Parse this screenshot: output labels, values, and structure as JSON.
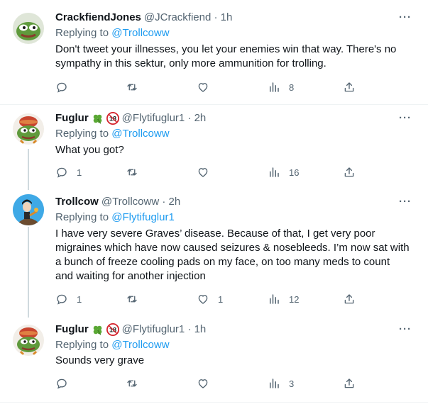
{
  "tweets": [
    {
      "name": "CrackfiendJones",
      "handle_time": "@JCrackfiend · 1h",
      "replying_prefix": "Replying to ",
      "replying_to": "@Trollcoww",
      "text": "Don't tweet your illnesses, you let your enemies win that way. There's no sympathy in this sektur, only more ammunition for trolling.",
      "replies": "",
      "retweets": "",
      "likes": "",
      "views": "8"
    },
    {
      "name": "Fuglur",
      "badges": [
        "four-leaf-clover-icon",
        "18-restriction-icon"
      ],
      "handle_time": "@Flytifuglur1 · 2h",
      "replying_prefix": "Replying to ",
      "replying_to": "@Trollcoww",
      "text": "What you got?",
      "replies": "1",
      "retweets": "",
      "likes": "",
      "views": "16"
    },
    {
      "name": "Trollcow",
      "handle_time": "@Trollcoww · 2h",
      "replying_prefix": "Replying to ",
      "replying_to": "@Flytifuglur1",
      "text": "I have very severe Graves’ disease. Because of that, I get very poor migraines which have now caused seizures & nosebleeds. I’m now sat with a bunch of freeze cooling pads on my face, on too many meds to count and waiting for another injection",
      "replies": "1",
      "retweets": "",
      "likes": "1",
      "views": "12"
    },
    {
      "name": "Fuglur",
      "badges": [
        "four-leaf-clover-icon",
        "18-restriction-icon"
      ],
      "handle_time": "@Flytifuglur1 · 1h",
      "replying_prefix": "Replying to ",
      "replying_to": "@Trollcoww",
      "text": "Sounds very grave",
      "replies": "",
      "retweets": "",
      "likes": "",
      "views": "3"
    }
  ],
  "icons": {
    "more": "more-options-icon",
    "reply": "reply-icon",
    "retweet": "retweet-icon",
    "like": "like-icon",
    "views": "views-icon",
    "share": "share-icon"
  },
  "colors": {
    "link": "#1d9bf0",
    "secondary_text": "#536471",
    "badge_red": "#d4212a",
    "clover_green": "#5aa834"
  }
}
